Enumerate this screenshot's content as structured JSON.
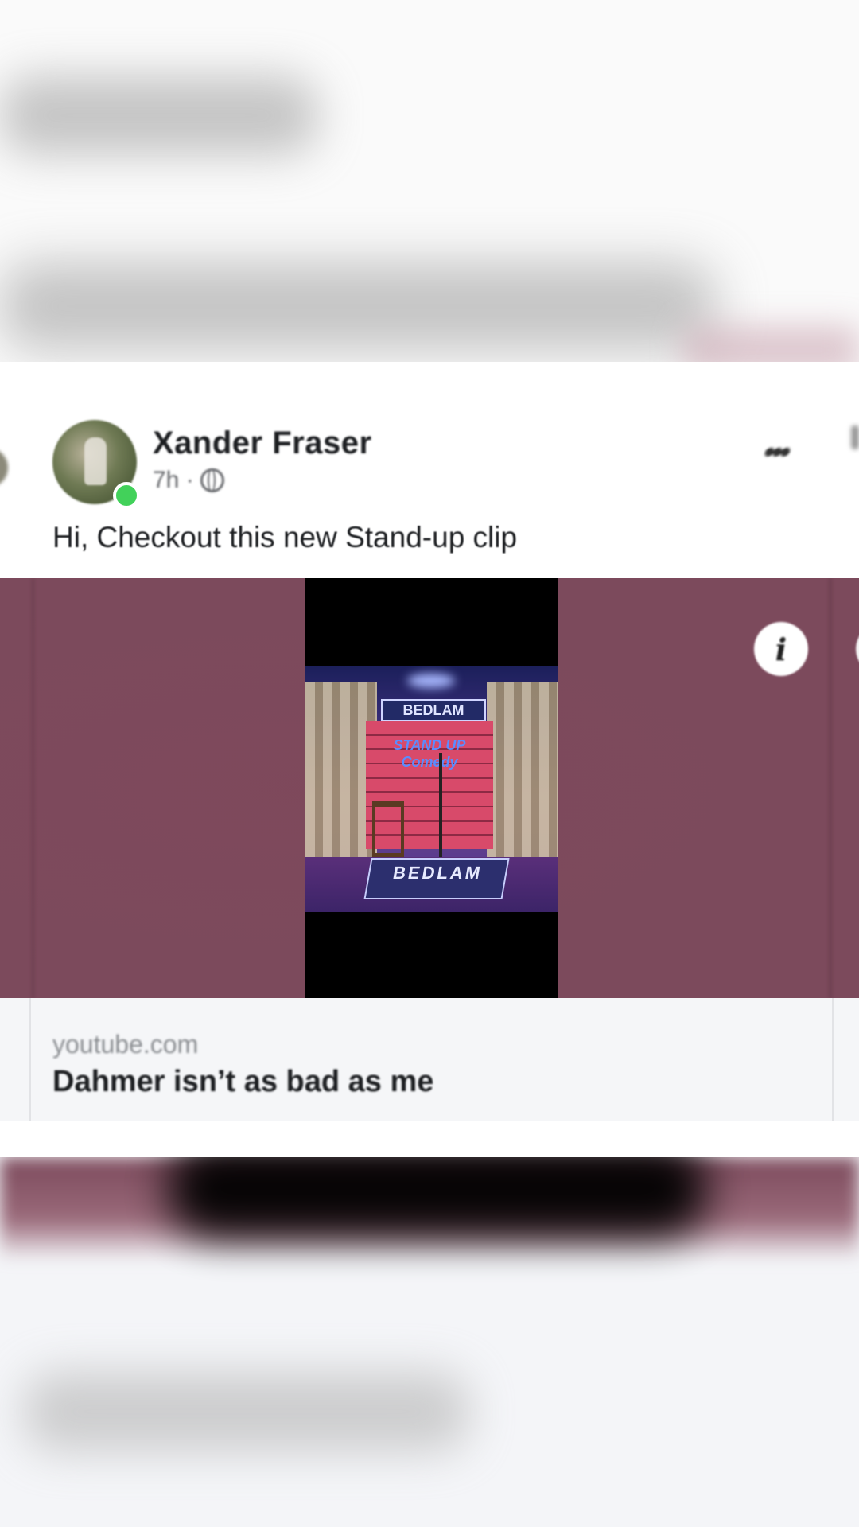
{
  "post": {
    "author_name": "Xander Fraser",
    "timestamp": "7h ·",
    "privacy_icon": "globe-icon",
    "caption": "Hi, Checkout this new Stand-up clip",
    "more_options_icon": "more-options-icon",
    "online_status": true
  },
  "media": {
    "thumbnail_banner_text": "BEDLAM",
    "thumbnail_sign_text": "STAND UP Comedy",
    "thumbnail_rug_text": "BEDLAM",
    "info_icon": "info-icon",
    "background_color": "#7c4a5c"
  },
  "link_preview": {
    "domain": "youtube.com",
    "title": "Dahmer isn’t as bad as me"
  },
  "colors": {
    "online_dot": "#42d15a",
    "text_primary": "#1c1e21",
    "text_secondary": "#65676b"
  }
}
